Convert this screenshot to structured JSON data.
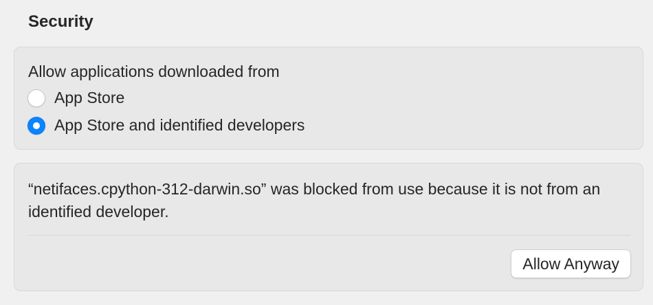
{
  "section": {
    "title": "Security"
  },
  "download_source": {
    "label": "Allow applications downloaded from",
    "options": [
      {
        "label": "App Store",
        "selected": false
      },
      {
        "label": "App Store and identified developers",
        "selected": true
      }
    ]
  },
  "blocked_notice": {
    "message": "“netifaces.cpython-312-darwin.so” was blocked from use because it is not from an identified developer.",
    "button_label": "Allow Anyway"
  },
  "colors": {
    "accent": "#0a84ff",
    "background": "#f0f0f0",
    "card": "#e8e8e8"
  }
}
